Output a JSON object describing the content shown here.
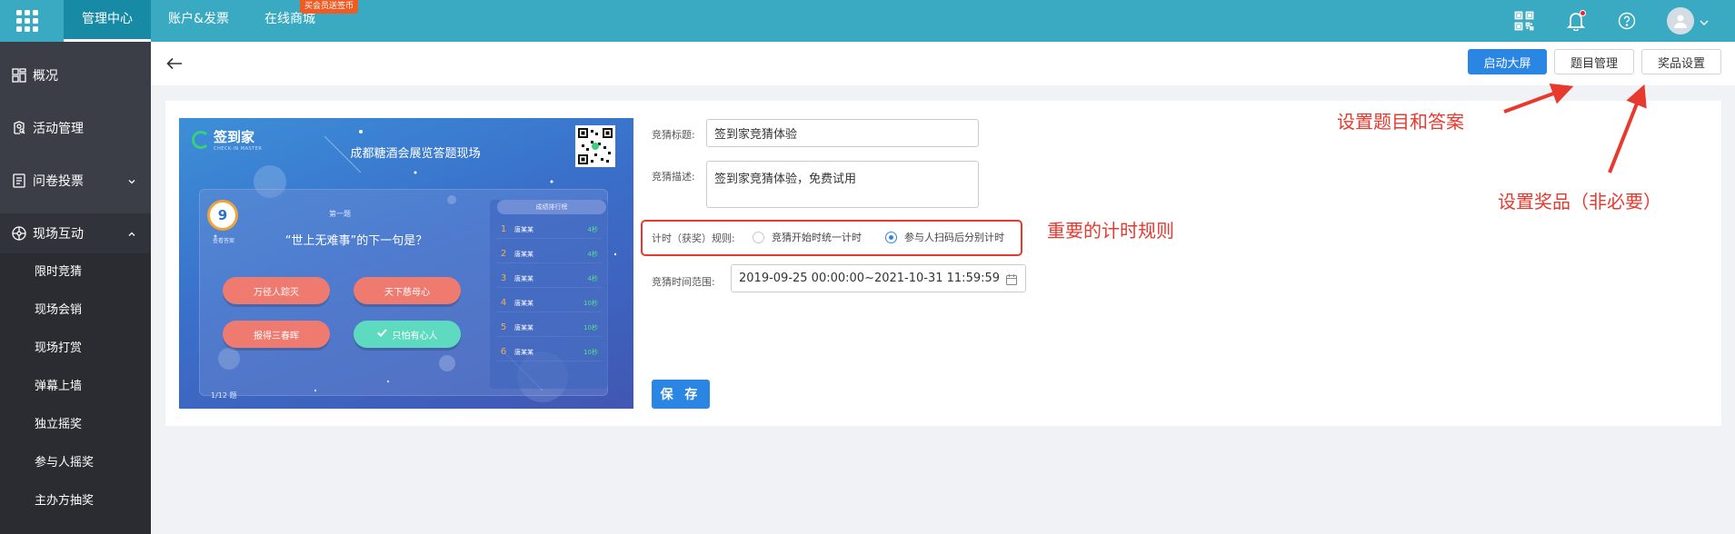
{
  "topbar": {
    "tabs": [
      {
        "label": "管理中心",
        "active": true
      },
      {
        "label": "账户&发票",
        "active": false
      },
      {
        "label": "在线商城",
        "active": false
      }
    ],
    "badge": "买会员送签币",
    "icons": [
      "apps-grid-icon",
      "qrcode-icon",
      "bell-icon",
      "help-icon",
      "avatar-icon",
      "chevron-down-icon"
    ],
    "accent_color": "#3aa9c2"
  },
  "sidebar": {
    "items": [
      {
        "label": "概况",
        "icon": "dashboard-icon"
      },
      {
        "label": "活动管理",
        "icon": "activity-icon"
      },
      {
        "label": "问卷投票",
        "icon": "survey-icon",
        "expandable": true
      },
      {
        "label": "现场互动",
        "icon": "interaction-icon",
        "expanded": true
      }
    ],
    "subitems": [
      "限时竞猜",
      "现场会销",
      "现场打赏",
      "弹幕上墙",
      "独立摇奖",
      "参与人摇奖",
      "主办方抽奖"
    ]
  },
  "header": {
    "buttons": {
      "launch": "启动大屏",
      "questions": "题目管理",
      "prizes": "奖品设置"
    }
  },
  "preview": {
    "logo": "签到家",
    "logo_sub": "CHECK-IN MASTER",
    "title": "成都糖酒会展览答题现场",
    "timer": "9",
    "timer_label": "查看答案",
    "question_num": "第一题",
    "question": "“世上无难事”的下一句是？",
    "options": [
      "万径人踪灭",
      "天下慈母心",
      "报得三春晖",
      "只怕有心人"
    ],
    "ranking_title": "成绩排行榜",
    "ranking": [
      {
        "rank": "1",
        "name": "唐某某",
        "time": "4秒"
      },
      {
        "rank": "2",
        "name": "唐某某",
        "time": "4秒"
      },
      {
        "rank": "3",
        "name": "唐某某",
        "time": "4秒"
      },
      {
        "rank": "4",
        "name": "唐某某",
        "time": "10秒"
      },
      {
        "rank": "5",
        "name": "唐某某",
        "time": "10秒"
      },
      {
        "rank": "6",
        "name": "唐某某",
        "time": "10秒"
      }
    ],
    "page": "1/12 题"
  },
  "form": {
    "title_label": "竞猜标题:",
    "title_value": "签到家竞猜体验",
    "desc_label": "竞猜描述:",
    "desc_value": "签到家竞猜体验，免费试用",
    "rule_label": "计时（获奖）规则:",
    "rule_options": [
      {
        "label": "竞猜开始时统一计时",
        "selected": false
      },
      {
        "label": "参与人扫码后分别计时",
        "selected": true
      }
    ],
    "range_label": "竞猜时间范围:",
    "range_value": "2019-09-25 00:00:00~2021-10-31 11:59:59",
    "save": "保 存"
  },
  "annotations": {
    "timing_rule": "重要的计时规则",
    "questions": "设置题目和答案",
    "prizes": "设置奖品（非必要）",
    "color": "#e8392e"
  }
}
